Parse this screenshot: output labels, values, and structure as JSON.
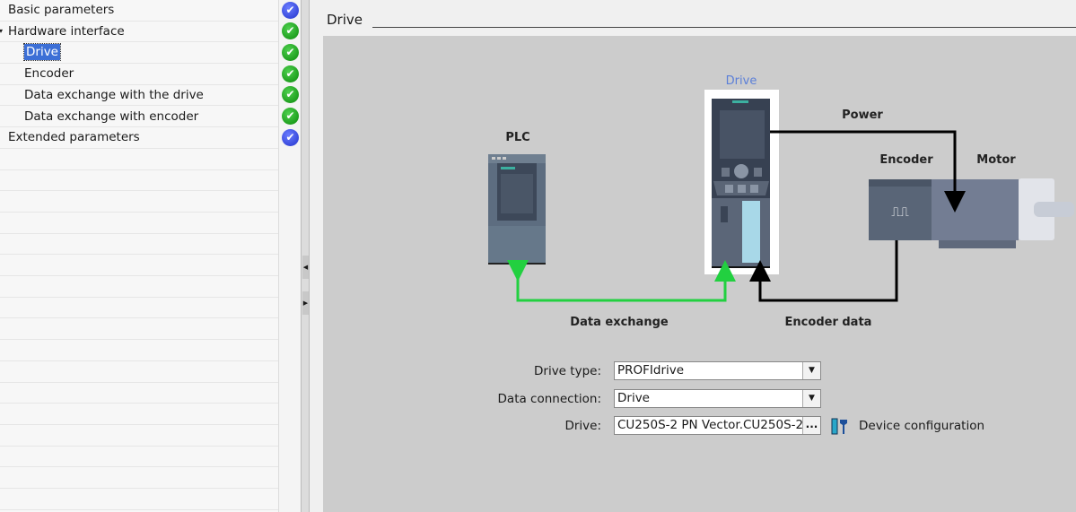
{
  "tree": [
    {
      "label": "Basic parameters",
      "status": "blue",
      "indent": 0
    },
    {
      "label": "Hardware interface",
      "status": "green",
      "indent": 0,
      "expanded": true
    },
    {
      "label": "Drive",
      "status": "green",
      "indent": 1,
      "selected": true
    },
    {
      "label": "Encoder",
      "status": "green",
      "indent": 1
    },
    {
      "label": "Data exchange with the drive",
      "status": "green",
      "indent": 1
    },
    {
      "label": "Data exchange with encoder",
      "status": "green",
      "indent": 1
    },
    {
      "label": "Extended parameters",
      "status": "blue",
      "indent": 0
    }
  ],
  "section": {
    "title": "Drive"
  },
  "diagram": {
    "plc": "PLC",
    "drive": "Drive",
    "power": "Power",
    "encoder": "Encoder",
    "motor": "Motor",
    "data_exchange": "Data exchange",
    "encoder_data": "Encoder data",
    "colors": {
      "data_exchange": "#22d040",
      "drive_label": "#5b7fd8"
    }
  },
  "form": {
    "drive_type_label": "Drive type:",
    "drive_type_value": "PROFIdrive",
    "data_connection_label": "Data connection:",
    "data_connection_value": "Drive",
    "drive_label": "Drive:",
    "drive_value": "CU250S-2 PN Vector.CU250S-2",
    "browse_label": "...",
    "device_config_label": "Device configuration"
  }
}
